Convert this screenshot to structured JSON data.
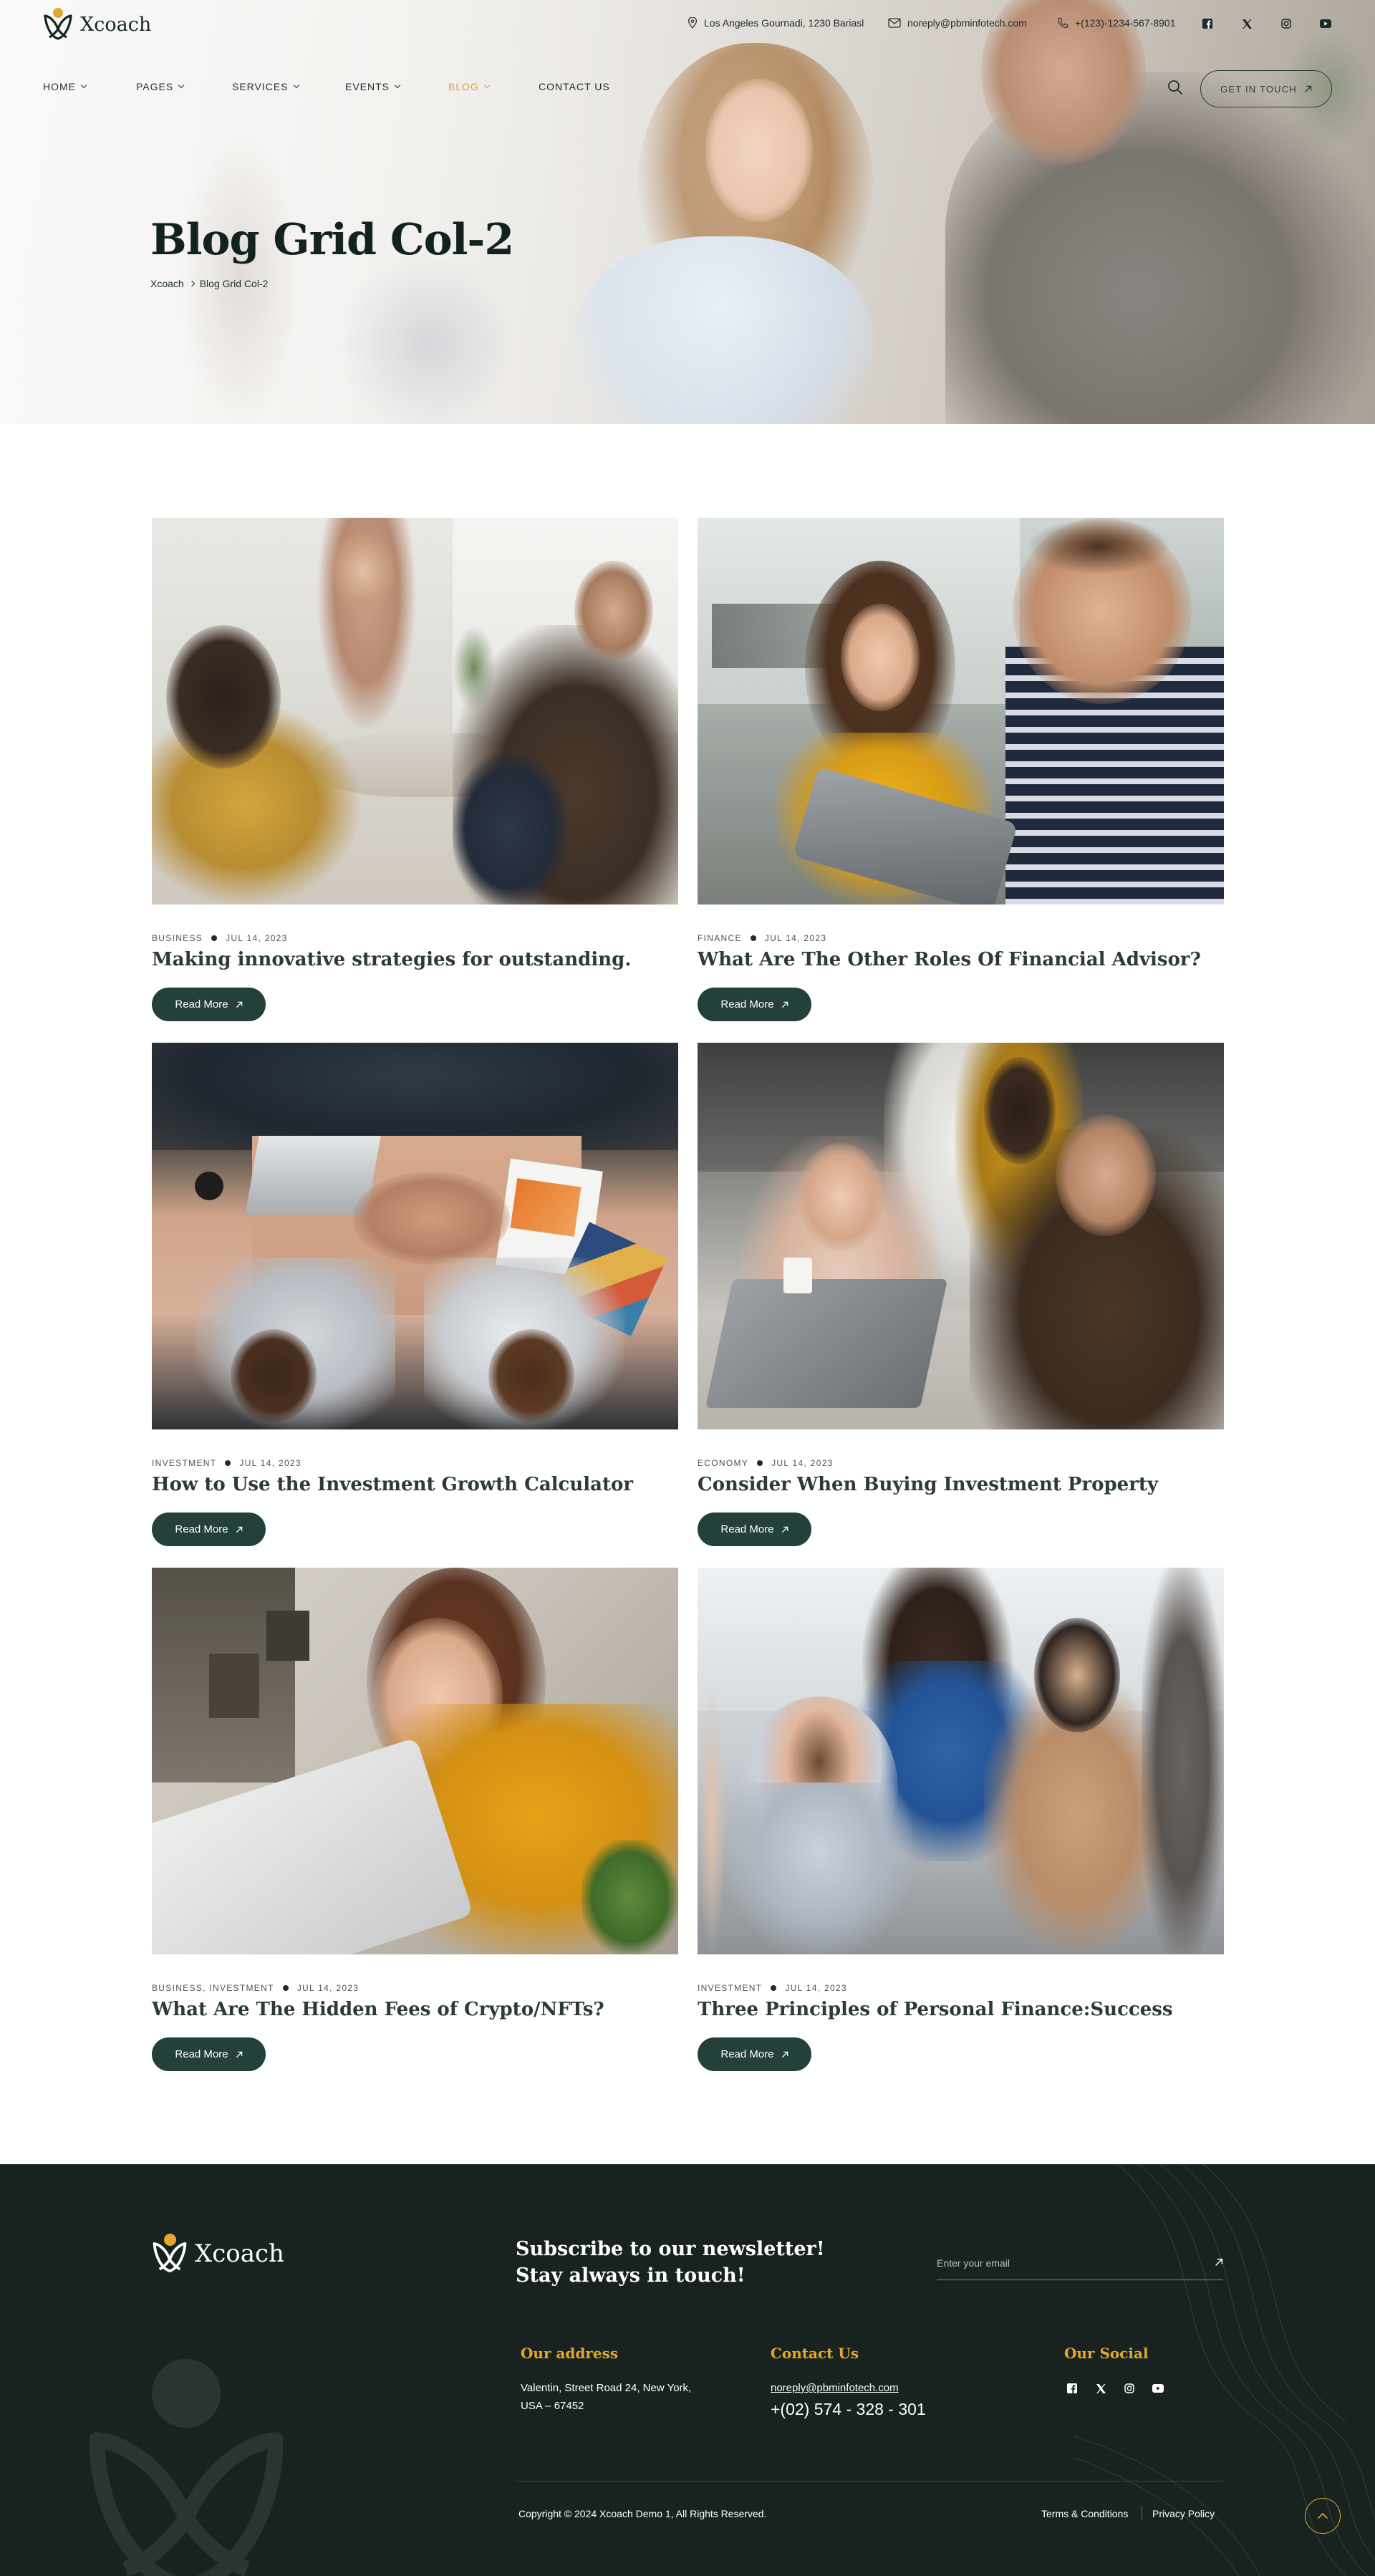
{
  "brand": {
    "name": "Xcoach"
  },
  "topbar": {
    "address": "Los Angeles Gournadi, 1230 Bariasl",
    "email": "noreply@pbminfotech.com",
    "phone": "+(123)-1234-567-8901",
    "social_icons": [
      "facebook-icon",
      "x-icon",
      "instagram-icon",
      "youtube-icon"
    ]
  },
  "nav": {
    "items": [
      {
        "label": "HOME",
        "dropdown": true
      },
      {
        "label": "PAGES",
        "dropdown": true
      },
      {
        "label": "SERVICES",
        "dropdown": true
      },
      {
        "label": "EVENTS",
        "dropdown": true
      },
      {
        "label": "BLOG",
        "dropdown": true,
        "active": true
      },
      {
        "label": "CONTACT US",
        "dropdown": false
      }
    ],
    "cta_label": "GET IN TOUCH"
  },
  "hero": {
    "title": "Blog Grid Col-2",
    "breadcrumb": [
      "Xcoach",
      "Blog Grid Col-2"
    ]
  },
  "posts": [
    {
      "category": "BUSINESS",
      "date": "JUL 14, 2023",
      "title": "Making innovative strategies for outstanding.",
      "button": "Read More"
    },
    {
      "category": "FINANCE",
      "date": "JUL 14, 2023",
      "title": "What Are The Other Roles Of Financial Advisor?",
      "button": "Read More"
    },
    {
      "category": "INVESTMENT",
      "date": "JUL 14, 2023",
      "title": "How to Use the Investment Growth Calculator",
      "button": "Read More"
    },
    {
      "category": "ECONOMY",
      "date": "JUL 14, 2023",
      "title": "Consider When Buying Investment Property",
      "button": "Read More"
    },
    {
      "category": "BUSINESS, INVESTMENT",
      "date": "JUL 14, 2023",
      "title": "What Are The Hidden Fees of Crypto/NFTs?",
      "button": "Read More"
    },
    {
      "category": "INVESTMENT",
      "date": "JUL 14, 2023",
      "title": "Three Principles of Personal Finance:Success",
      "button": "Read More"
    }
  ],
  "footer": {
    "newsletter_title": "Subscribe to our newsletter! Stay always in touch!",
    "email_placeholder": "Enter your email",
    "address_heading": "Our address",
    "address_text": "Valentin, Street Road 24, New York, USA – 67452",
    "contact_heading": "Contact Us",
    "contact_email": "noreply@pbminfotech.com",
    "contact_phone": "+(02) 574 - 328 - 301",
    "social_heading": "Our Social",
    "copyright": "Copyright © 2024 Xcoach Demo 1, All Rights Reserved.",
    "links": [
      "Terms & Conditions",
      "Privacy Policy"
    ]
  },
  "colors": {
    "accent": "#e3a72f",
    "active_nav": "#d9a03d",
    "button": "#23403a",
    "footer_bg": "#18231f"
  }
}
